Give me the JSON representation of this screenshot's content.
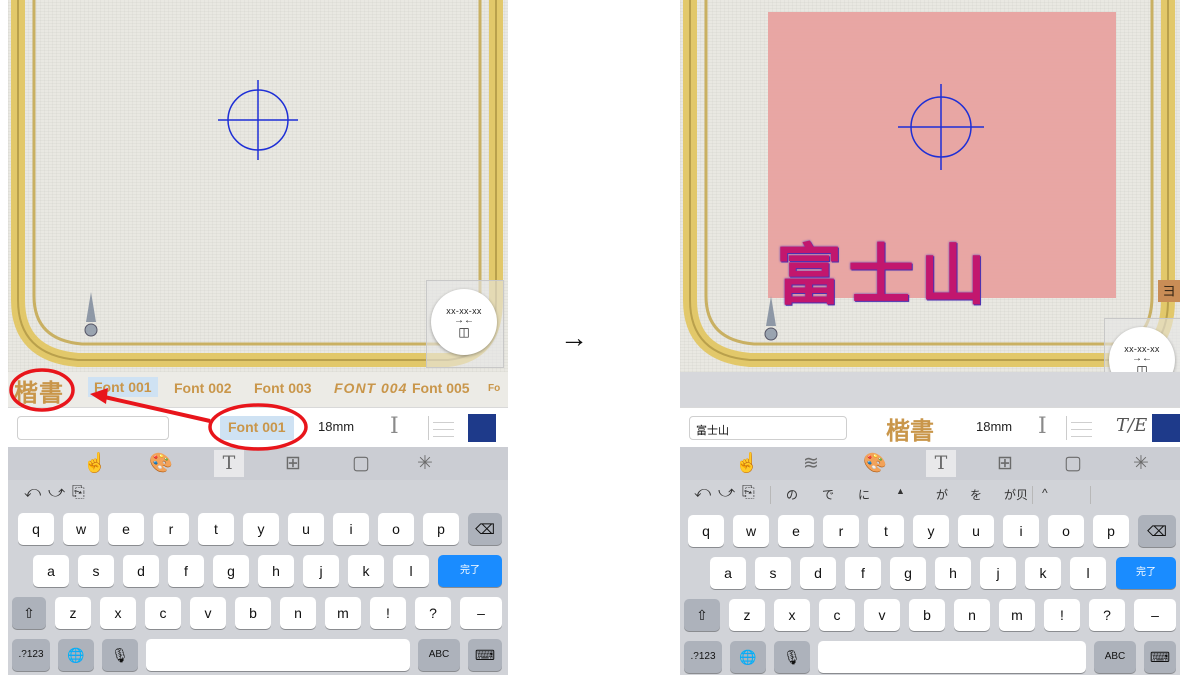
{
  "left": {
    "canvas": {
      "size_chip": {
        "dims": "xx-xx-xx",
        "arrows": "→←",
        "glyph": "◫"
      }
    },
    "font_strip": {
      "kaisho": "楷書",
      "fonts": [
        "Font 001",
        "Font 002",
        "Font 003",
        "FONT 004",
        "Font 005",
        "Fo"
      ]
    },
    "input_row": {
      "text_value": "",
      "font_button": "Font 001",
      "size": "18mm"
    }
  },
  "transition_arrow": "→",
  "right": {
    "canvas": {
      "embroidery_text": "富士山",
      "size_chip": {
        "dims": "xx-xx-xx",
        "arrows": "→←",
        "glyph": "◫"
      },
      "side_tab": "ヨ"
    },
    "input_row": {
      "text_value": "富士山",
      "kaisho": "楷書",
      "size": "18mm",
      "te_icon": "T/E"
    },
    "candidates": [
      "の",
      "で",
      "に",
      "▲",
      "が",
      "を",
      "が贝",
      "^"
    ]
  },
  "keyboard": {
    "undo": "⤺",
    "redo": "⤻",
    "clipboard": "⎘",
    "row1": [
      "q",
      "w",
      "e",
      "r",
      "t",
      "y",
      "u",
      "i",
      "o",
      "p"
    ],
    "backspace": "⌫",
    "row2": [
      "a",
      "s",
      "d",
      "f",
      "g",
      "h",
      "j",
      "k",
      "l"
    ],
    "done": "完了",
    "shift": "⇧",
    "row3": [
      "z",
      "x",
      "c",
      "v",
      "b",
      "n",
      "m",
      "!",
      "?",
      "–"
    ],
    "row3_sub": {
      "!": "、",
      "?": "。"
    },
    "numbers": ".?123",
    "globe": "🌐",
    "mic": "🎙",
    "abc": "ABC",
    "hide": "⌨"
  },
  "colors": {
    "annotation": "#e8151b",
    "crosshair": "#1e2fd6",
    "font_gold": "#c9964a",
    "hoop": "#e2c86a",
    "thread_blue": "#1e3a8a",
    "design_pink": "#e8a2a0"
  },
  "icons": {
    "toolbar_left": [
      "touch-hand-icon",
      "palette-icon",
      "text-icon",
      "arrange-icon",
      "frame-icon",
      "magic-select-icon"
    ],
    "toolbar_right": [
      "touch-hand-icon",
      "stitch-icon",
      "palette-icon",
      "text-icon",
      "arrange-icon",
      "frame-icon",
      "magic-select-icon"
    ]
  }
}
